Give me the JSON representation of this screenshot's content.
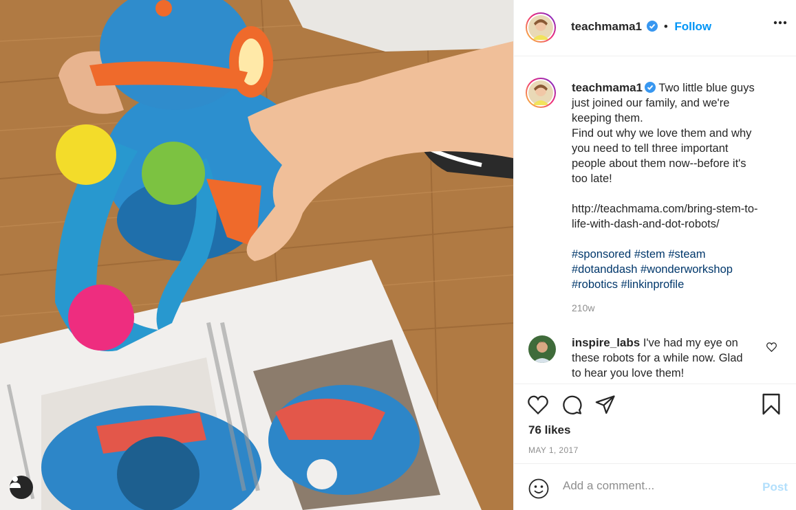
{
  "post": {
    "author": {
      "username": "teachmama1",
      "verified": true,
      "follow_label": "Follow",
      "separator": "•"
    },
    "caption": {
      "lines": [
        "Two little blue guys",
        "just joined our family, and we're",
        "keeping them.",
        "Find out why we love them and why",
        "you need to tell three important",
        "people about them now--before it's",
        "too late!"
      ],
      "link_lines": [
        "http://teachmama.com/bring-stem-to-",
        "life-with-dash-and-dot-robots/"
      ],
      "hashtags": [
        "#sponsored",
        "#stem",
        "#steam",
        "#dotanddash",
        "#wonderworkshop",
        "#robotics",
        "#linkinprofile"
      ],
      "time_ago": "210w"
    },
    "comments": [
      {
        "username": "inspire_labs",
        "lines": [
          "I've had my eye on",
          "these robots for a while now. Glad",
          "to hear you love them!"
        ]
      }
    ],
    "likes": "76 likes",
    "date": "MAY 1, 2017",
    "add_comment": {
      "placeholder": "Add a comment...",
      "post_label": "Post"
    }
  },
  "icons": {
    "more": "more-options-icon",
    "verified": "verified-badge-icon",
    "like": "heart-icon",
    "comment": "comment-icon",
    "share": "share-icon",
    "save": "bookmark-icon",
    "emoji": "emoji-icon",
    "user_tag": "user-tag-icon"
  },
  "colors": {
    "accent": "#0095f6",
    "hashtag": "#00376b",
    "muted": "#8e8e8e",
    "post_disabled": "#b2dffc"
  }
}
